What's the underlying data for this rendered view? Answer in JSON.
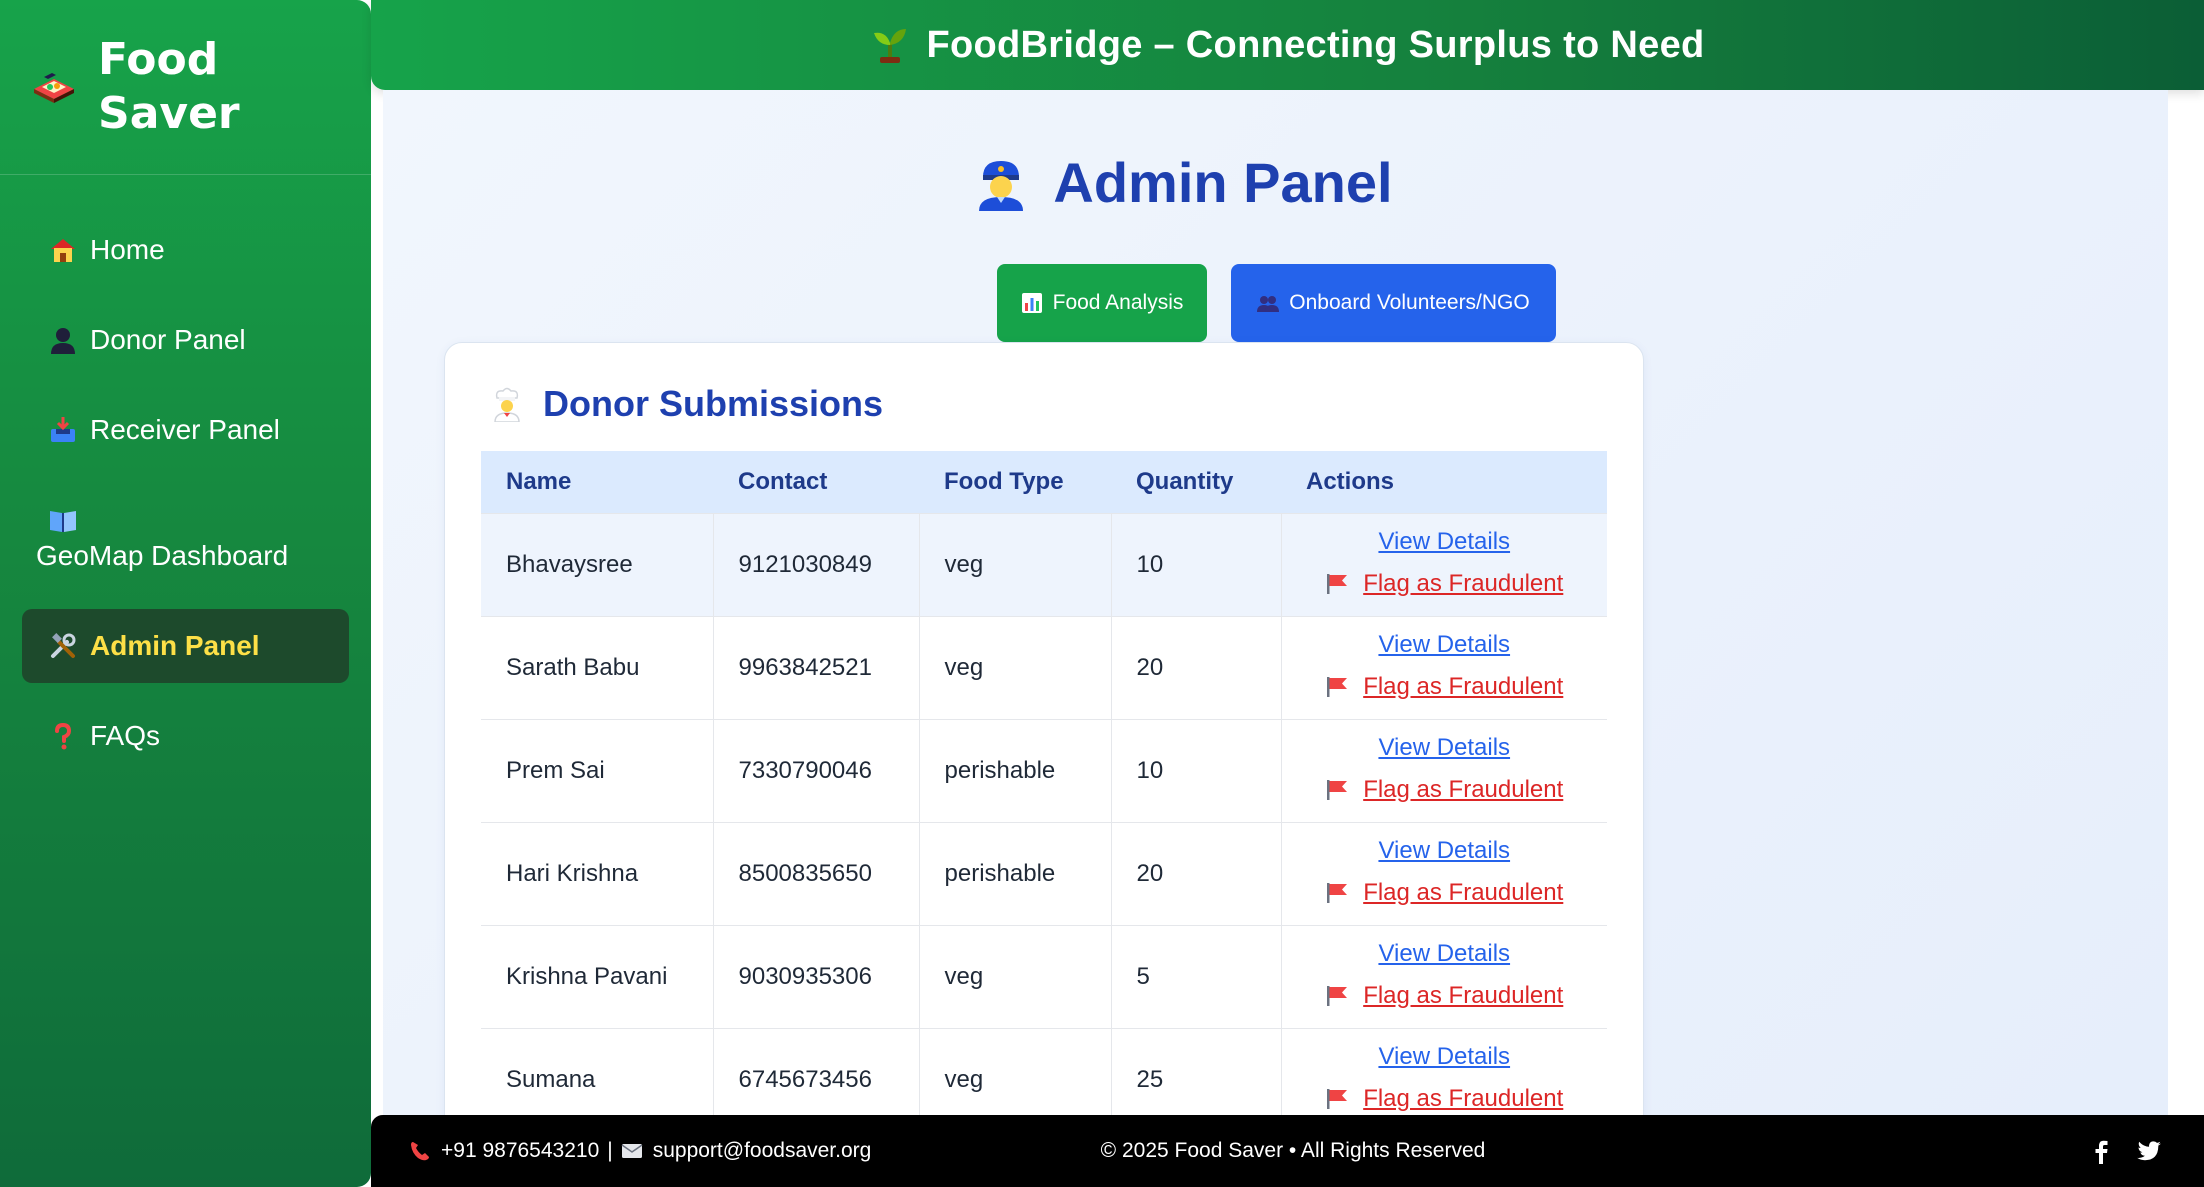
{
  "sidebar": {
    "brand": "Food Saver",
    "items": [
      {
        "label": "Home",
        "icon": "house-icon"
      },
      {
        "label": "Donor Panel",
        "icon": "person-icon"
      },
      {
        "label": "Receiver Panel",
        "icon": "inbox-tray-icon"
      },
      {
        "label": "GeoMap Dashboard",
        "icon": "map-book-icon"
      },
      {
        "label": "Admin Panel",
        "icon": "tools-icon",
        "active": true
      },
      {
        "label": "FAQs",
        "icon": "question-mark-icon"
      }
    ]
  },
  "header": {
    "title": "FoodBridge – Connecting Surplus to Need",
    "icon": "seedling-icon"
  },
  "main": {
    "page_title": "Admin Panel",
    "buttons": {
      "food_analysis": "Food Analysis",
      "onboard": "Onboard Volunteers/NGO"
    },
    "card_title": "Donor Submissions",
    "table": {
      "headers": [
        "Name",
        "Contact",
        "Food Type",
        "Quantity",
        "Actions"
      ],
      "rows": [
        [
          "Bhavaysree",
          "9121030849",
          "veg",
          "10"
        ],
        [
          "Sarath Babu",
          "9963842521",
          "veg",
          "20"
        ],
        [
          "Prem Sai",
          "7330790046",
          "perishable",
          "10"
        ],
        [
          "Hari Krishna",
          "8500835650",
          "perishable",
          "20"
        ],
        [
          "Krishna Pavani",
          "9030935306",
          "veg",
          "5"
        ],
        [
          "Sumana",
          "6745673456",
          "veg",
          "25"
        ]
      ],
      "actions": {
        "view": "View Details",
        "flag": "Flag as Fraudulent"
      }
    }
  },
  "footer": {
    "phone": "+91 9876543210",
    "separator": "|",
    "email": "support@foodsaver.org",
    "copyright": "© 2025 Food Saver • All Rights Reserved"
  },
  "colors": {
    "primary_green": "#16a34a",
    "primary_blue": "#2563eb",
    "title_blue": "#1e40af",
    "flag_red": "#dc2626",
    "active_text": "#fde047"
  }
}
